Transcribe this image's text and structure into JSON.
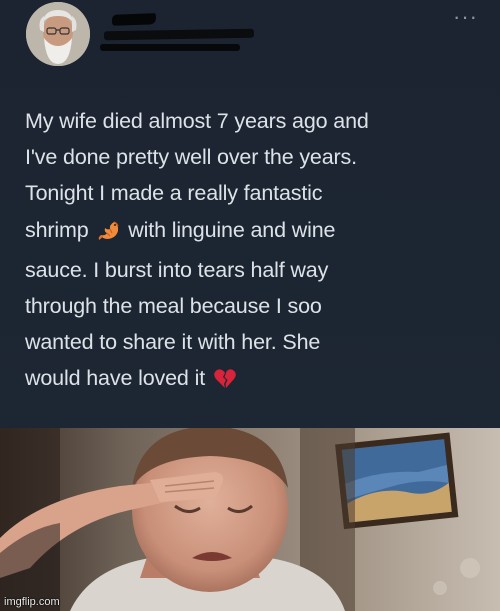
{
  "tweet": {
    "text_lines": [
      "My wife died almost 7 years ago and",
      "I've done pretty well over the years.",
      "Tonight I made a really fantastic",
      "with linguine and wine",
      "sauce. I burst into tears half way",
      "through the meal because I soo",
      "wanted to share it with her. She",
      "would have loved it"
    ],
    "shrimp_word": "shrimp",
    "icons": [
      "more-options-icon",
      "shrimp-emoji-icon",
      "broken-heart-emoji-icon"
    ],
    "colors": {
      "background": "#1b2430",
      "text": "#dde2e8",
      "broken_heart": "#d8243a"
    }
  },
  "photo": {
    "watermark": "imgflip.com"
  }
}
